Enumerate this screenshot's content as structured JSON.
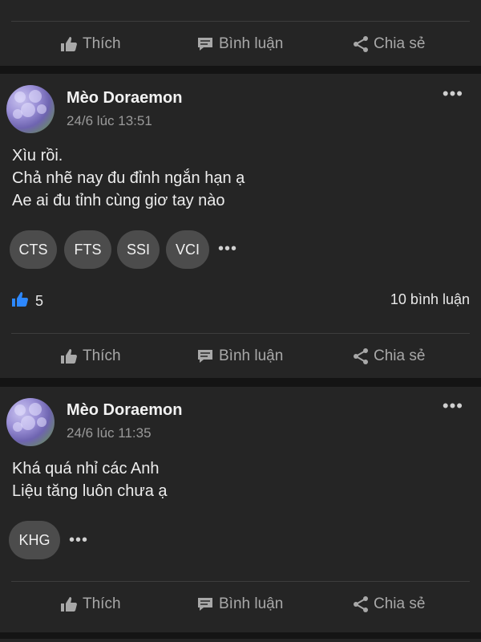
{
  "actions": {
    "like": "Thích",
    "comment": "Bình luận",
    "share": "Chia sẻ"
  },
  "posts": [
    {
      "author": "Mèo Doraemon",
      "time": "24/6 lúc 13:51",
      "lines": [
        "Xìu rồi.",
        "Chả nhẽ nay đu đỉnh ngắn hạn ạ",
        "Ae ai đu tỉnh cùng giơ tay nào"
      ],
      "tags": [
        "CTS",
        "FTS",
        "SSI",
        "VCI"
      ],
      "likes": "5",
      "comments": "10 bình luận"
    },
    {
      "author": "Mèo Doraemon",
      "time": "24/6 lúc 11:35",
      "lines": [
        "Khá quá nhỉ các Anh",
        "Liệu tăng luôn chưa ạ"
      ],
      "tags": [
        "KHG"
      ]
    }
  ],
  "colors": {
    "like_accent": "#2d88ff",
    "card_bg": "#252525",
    "page_bg": "#141414"
  }
}
